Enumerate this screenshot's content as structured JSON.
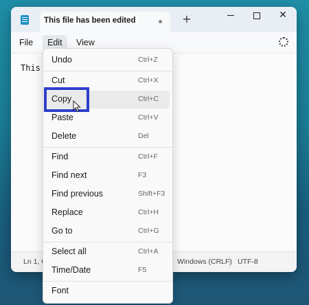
{
  "window": {
    "tab_title": "This file has been edited",
    "new_tab": "+",
    "controls": {
      "minimize": "minimize-icon",
      "maximize": "maximize-icon",
      "close": "close-icon"
    }
  },
  "menubar": {
    "file": "File",
    "edit": "Edit",
    "view": "View",
    "settings_icon": "gear-icon"
  },
  "editor": {
    "text": "This"
  },
  "status": {
    "ln_col": "Ln 1, C",
    "eol": "Windows (CRLF)",
    "encoding": "UTF-8"
  },
  "edit_menu": {
    "items": [
      {
        "label": "Undo",
        "shortcut": "Ctrl+Z"
      },
      {
        "label": "Cut",
        "shortcut": "Ctrl+X"
      },
      {
        "label": "Copy",
        "shortcut": "Ctrl+C"
      },
      {
        "label": "Paste",
        "shortcut": "Ctrl+V"
      },
      {
        "label": "Delete",
        "shortcut": "Del"
      },
      {
        "label": "Find",
        "shortcut": "Ctrl+F"
      },
      {
        "label": "Find next",
        "shortcut": "F3"
      },
      {
        "label": "Find previous",
        "shortcut": "Shift+F3"
      },
      {
        "label": "Replace",
        "shortcut": "Ctrl+H"
      },
      {
        "label": "Go to",
        "shortcut": "Ctrl+G"
      },
      {
        "label": "Select all",
        "shortcut": "Ctrl+A"
      },
      {
        "label": "Time/Date",
        "shortcut": "F5"
      },
      {
        "label": "Font",
        "shortcut": ""
      }
    ],
    "highlighted_item": "Copy"
  },
  "colors": {
    "highlight_box": "#2f3fc9",
    "app_icon": "#1d8fc2"
  }
}
